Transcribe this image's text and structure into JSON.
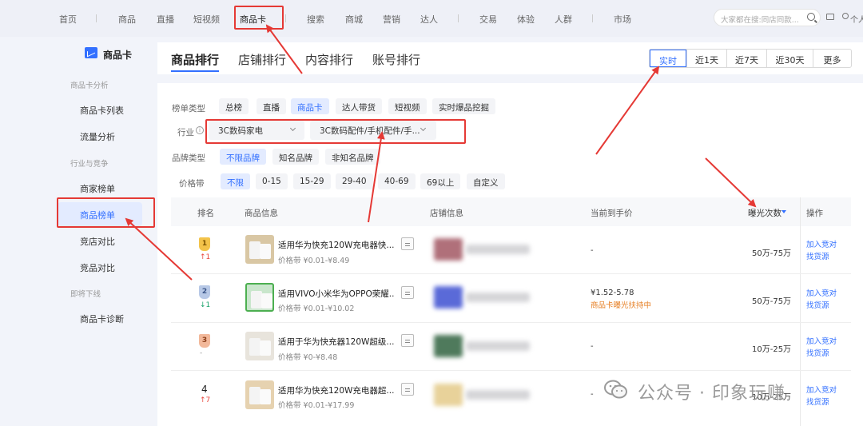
{
  "top_nav": {
    "items": [
      "首页",
      "商品",
      "直播",
      "短视频",
      "商品卡",
      "搜索",
      "商城",
      "营销",
      "达人",
      "交易",
      "体验",
      "人群",
      "市场"
    ],
    "search_placeholder": "大家都在搜:同店同款...",
    "user_label": "个人"
  },
  "sidebar": {
    "title": "商品卡",
    "groups": [
      {
        "label": "商品卡分析",
        "items": [
          "商品卡列表",
          "流量分析"
        ]
      },
      {
        "label": "行业与竞争",
        "items": [
          "商家榜单",
          "商品榜单",
          "竞店对比",
          "竞品对比"
        ]
      },
      {
        "label": "即将下线",
        "items": [
          "商品卡诊断"
        ]
      }
    ],
    "active_item": "商品榜单"
  },
  "main_tabs": [
    "商品排行",
    "店铺排行",
    "内容排行",
    "账号排行"
  ],
  "time_range": {
    "options": [
      "实时",
      "近1天",
      "近7天",
      "近30天",
      "更多"
    ],
    "selected": "实时"
  },
  "filters": {
    "list_type": {
      "label": "榜单类型",
      "options": [
        "总榜",
        "直播",
        "商品卡",
        "达人带货",
        "短视频",
        "实时爆品挖掘"
      ],
      "selected": "商品卡"
    },
    "industry": {
      "label": "行业",
      "info_icon": "i",
      "primary": "3C数码家电",
      "secondary": "3C数码配件/手机配件/手..."
    },
    "brand_type": {
      "label": "品牌类型",
      "options": [
        "不限品牌",
        "知名品牌",
        "非知名品牌"
      ],
      "selected": "不限品牌"
    },
    "price_band": {
      "label": "价格带",
      "options": [
        "不限",
        "0-15",
        "15-29",
        "29-40",
        "40-69",
        "69以上",
        "自定义"
      ],
      "selected": "不限"
    }
  },
  "table": {
    "columns": [
      "排名",
      "商品信息",
      "店铺信息",
      "当前到手价",
      "曝光次数",
      "操作"
    ],
    "sort_column": "曝光次数",
    "rows": [
      {
        "rank": "1",
        "badge_top": "TOP",
        "trend": "↑1",
        "trend_dir": "up",
        "name": "适用华为快充120W充电器快...",
        "price_band": "价格带 ¥0.01-¥8.49",
        "price": "-",
        "price_tag": "",
        "exposure": "50万-75万",
        "op1": "加入竞对",
        "op2": "找货源",
        "store_color": "#b0707a"
      },
      {
        "rank": "2",
        "badge_top": "TOP",
        "trend": "↓1",
        "trend_dir": "down",
        "name": "适用VIVO小米华为OPPO荣耀...",
        "price_band": "价格带 ¥0.01-¥10.02",
        "price": "¥1.52-5.78",
        "price_tag": "商品卡曝光扶持中",
        "exposure": "50万-75万",
        "op1": "加入竞对",
        "op2": "找货源",
        "store_color": "#5a6ad8"
      },
      {
        "rank": "3",
        "badge_top": "TOP",
        "trend": "-",
        "trend_dir": "",
        "name": "适用于华为快充器120W超级...",
        "price_band": "价格带 ¥0-¥8.48",
        "price": "-",
        "price_tag": "",
        "exposure": "10万-25万",
        "op1": "加入竞对",
        "op2": "找货源",
        "store_color": "#4f7a5c"
      },
      {
        "rank": "4",
        "badge_top": "",
        "trend": "↑7",
        "trend_dir": "up",
        "name": "适用华为快充120W充电器超...",
        "price_band": "价格带 ¥0.01-¥17.99",
        "price": "-",
        "price_tag": "",
        "exposure": "10万-25万",
        "op1": "加入竞对",
        "op2": "找货源",
        "store_color": "#e8d29a"
      }
    ]
  },
  "watermark": {
    "text": "公众号 · 印象玩赚"
  },
  "colors": {
    "accent": "#3370ff",
    "annotation": "#e53935",
    "up": "#e8453c",
    "down": "#1aa36b",
    "tag": "#e67e22"
  }
}
